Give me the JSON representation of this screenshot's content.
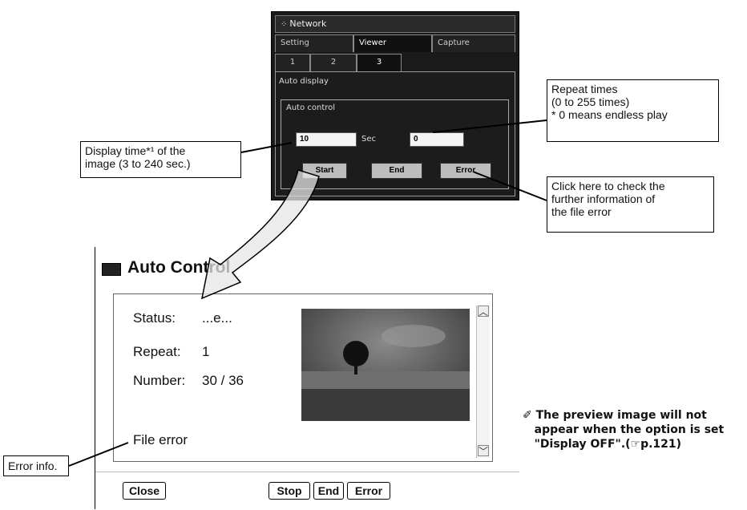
{
  "network_panel": {
    "title": "Network",
    "tabs": [
      "Setting",
      "Viewer",
      "Capture"
    ],
    "subtabs": [
      "1",
      "2",
      "3"
    ],
    "section_auto_display": "Auto display",
    "section_auto_control": "Auto control",
    "display_time_value": "10",
    "display_time_unit": "Sec",
    "repeat_value": "0",
    "buttons": {
      "start": "Start",
      "end": "End",
      "error": "Error"
    }
  },
  "callouts": {
    "repeat_times": [
      "Repeat times",
      "(0 to 255 times)",
      "* 0 means endless play"
    ],
    "display_time": [
      "Display time*¹ of the",
      "image (3 to 240 sec.)"
    ],
    "error_check": [
      "Click here to check the",
      "further information of",
      "the file error"
    ],
    "error_info": "Error info."
  },
  "auto_control": {
    "title": "Auto Control",
    "status_label": "Status:",
    "status_value": "...e...",
    "repeat_label": "Repeat:",
    "repeat_value": "1",
    "number_label": "Number:",
    "number_value": "30 / 36",
    "error_text": "File error",
    "buttons": {
      "close": "Close",
      "stop": "Stop",
      "end": "End",
      "error": "Error"
    }
  },
  "note": "✐ The preview image will not\n   appear when the option is set\n   \"Display OFF\".(☞p.121)"
}
